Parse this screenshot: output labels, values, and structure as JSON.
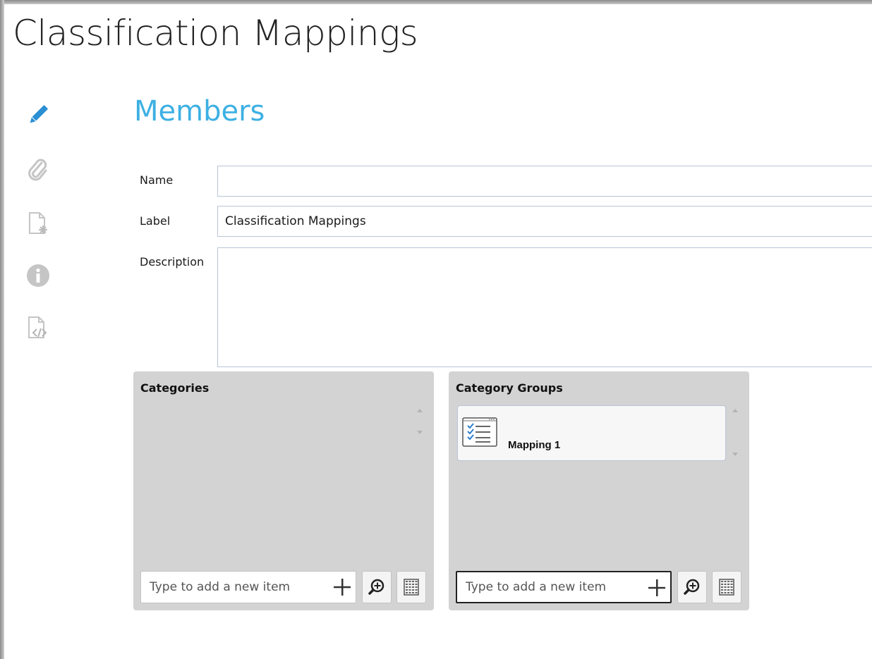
{
  "page": {
    "title": "Classification Mappings"
  },
  "sidebar": {
    "icons": [
      "pencil-icon",
      "paperclip-icon",
      "document-asterisk-icon",
      "info-icon",
      "document-code-icon"
    ],
    "active_color": "#2b8fd4",
    "inactive_color": "#c5c5c5"
  },
  "section": {
    "title": "Members",
    "color": "#3db0e3"
  },
  "form": {
    "name": {
      "label": "Name",
      "value": ""
    },
    "label": {
      "label": "Label",
      "value": "Classification Mappings"
    },
    "description": {
      "label": "Description",
      "value": ""
    }
  },
  "categories_panel": {
    "title": "Categories",
    "items": [],
    "add_placeholder": "Type to add a new item"
  },
  "category_groups_panel": {
    "title": "Category Groups",
    "items": [
      {
        "label": "Mapping 1",
        "icon": "checklist-icon"
      }
    ],
    "add_placeholder": "Type to add a new item"
  }
}
